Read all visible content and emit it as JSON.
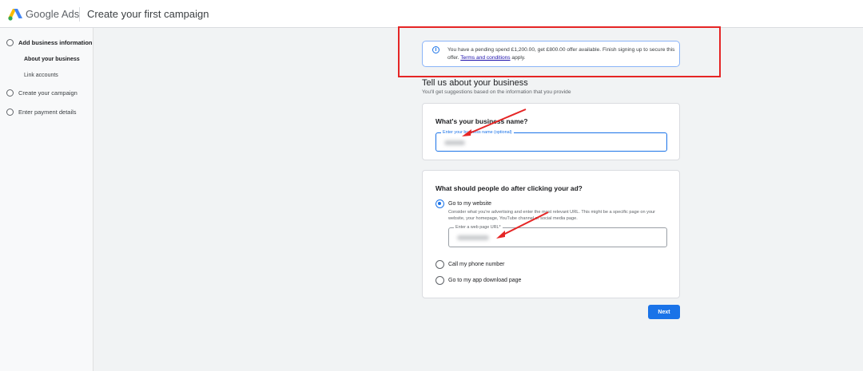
{
  "header": {
    "logo_text": "Google Ads",
    "page_title": "Create your first campaign",
    "logo_colors": [
      "#fbbc04",
      "#4285f4",
      "#34a853"
    ]
  },
  "sidebar": {
    "steps": [
      {
        "label": "Add business information",
        "state": "active"
      },
      {
        "label": "Create your campaign",
        "state": "todo"
      },
      {
        "label": "Enter payment details",
        "state": "todo"
      }
    ],
    "substeps": [
      {
        "label": "About your business",
        "state": "current"
      },
      {
        "label": "Link accounts",
        "state": "todo"
      }
    ]
  },
  "offer": {
    "icon": "info-icon",
    "text": "You have a pending spend £1,200.00, get £800.00 offer available. Finish signing up to secure this offer.",
    "link_text": "Terms and conditions",
    "suffix": "apply."
  },
  "section": {
    "title": "Tell us about your business",
    "subtitle": "You'll get suggestions based on the information that you provide"
  },
  "business_card": {
    "heading": "What's your business name?",
    "field_label": "Enter your business name (optional)",
    "field_value": ""
  },
  "action_card": {
    "heading": "What should people do after clicking your ad?",
    "options": [
      {
        "label": "Go to my website",
        "selected": true
      },
      {
        "label": "Call my phone number",
        "selected": false
      },
      {
        "label": "Go to my app download page",
        "selected": false
      }
    ],
    "website_help": "Consider what you're advertising and enter the most relevant URL. This might be a specific page on your website, your homepage, YouTube channel or social media page.",
    "url_label": "Enter a web page URL*",
    "url_value": ""
  },
  "footer": {
    "next_label": "Next"
  },
  "colors": {
    "accent": "#1a73e8",
    "annotation_red": "#e52525"
  }
}
